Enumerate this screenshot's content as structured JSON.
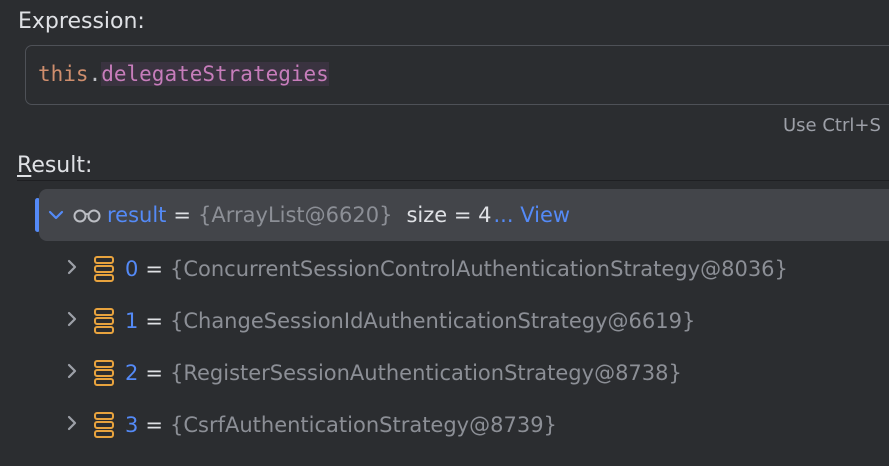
{
  "expression": {
    "label": "Expression:",
    "code_keyword": "this",
    "code_dot": ".",
    "code_field": "delegateStrategies",
    "hint": "Use Ctrl+S"
  },
  "result": {
    "label_first": "R",
    "label_rest": "esult:",
    "root": {
      "name": "result",
      "eq": "=",
      "value": "{ArrayList@6620}",
      "size": "size = 4",
      "view": "... View",
      "icon": "glasses-icon"
    },
    "children": [
      {
        "name": "0",
        "eq": "=",
        "value": "{ConcurrentSessionControlAuthenticationStrategy@8036}",
        "icon": "list-icon"
      },
      {
        "name": "1",
        "eq": "=",
        "value": "{ChangeSessionIdAuthenticationStrategy@6619}",
        "icon": "list-icon"
      },
      {
        "name": "2",
        "eq": "=",
        "value": "{RegisterSessionAuthenticationStrategy@8738}",
        "icon": "list-icon"
      },
      {
        "name": "3",
        "eq": "=",
        "value": "{CsrfAuthenticationStrategy@8739}",
        "icon": "list-icon"
      }
    ]
  },
  "colors": {
    "background": "#2b2d30",
    "accent": "#548af7",
    "keyword": "#cf8e6d",
    "field": "#c77dbb",
    "icon_orange": "#e8a33e"
  }
}
